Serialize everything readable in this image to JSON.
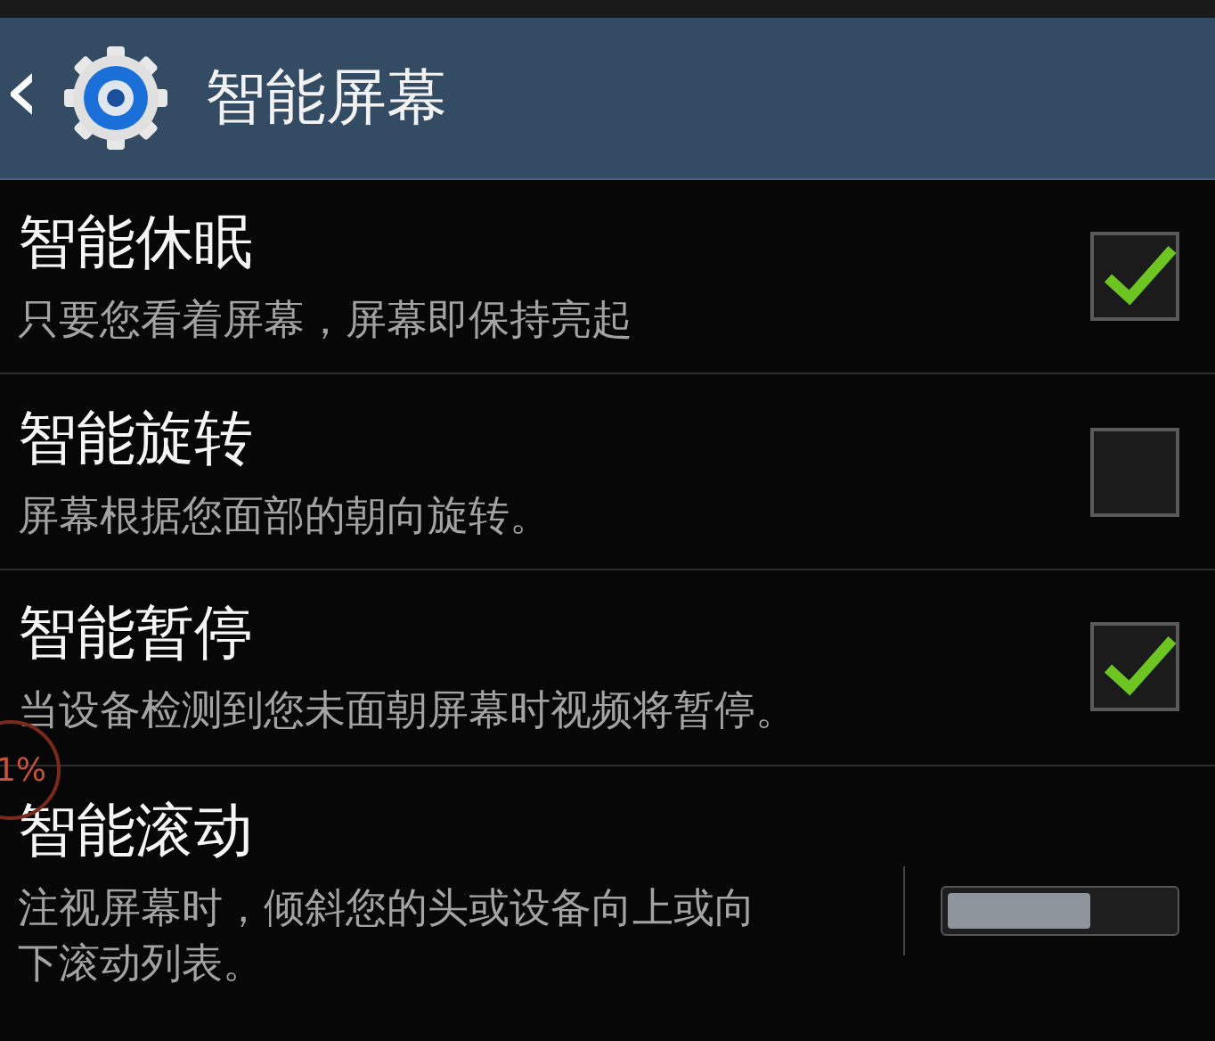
{
  "header": {
    "back": "‹",
    "title": "智能屏幕"
  },
  "items": [
    {
      "kind": "checkbox",
      "title": "智能休眠",
      "summary": "只要您看着屏幕，屏幕即保持亮起",
      "checked": true
    },
    {
      "kind": "checkbox",
      "title": "智能旋转",
      "summary": "屏幕根据您面部的朝向旋转。",
      "checked": false
    },
    {
      "kind": "checkbox",
      "title": "智能暂停",
      "summary": "当设备检测到您未面朝屏幕时视频将暂停。",
      "checked": true
    },
    {
      "kind": "switch",
      "title": "智能滚动",
      "summary": "注视屏幕时，倾斜您的头或设备向上或向下滚动列表。",
      "on": false
    }
  ],
  "overlay": {
    "text": "1%"
  }
}
